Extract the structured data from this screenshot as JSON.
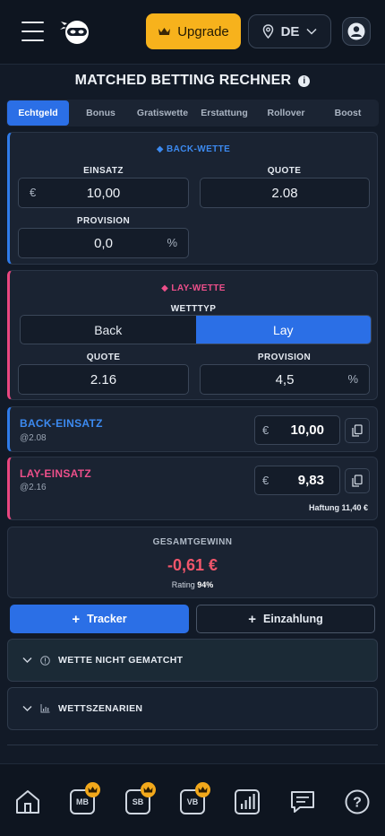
{
  "header": {
    "upgrade_label": "Upgrade",
    "region_label": "DE"
  },
  "page": {
    "title": "MATCHED BETTING RECHNER",
    "info_glyph": "i"
  },
  "tabs": [
    {
      "label": "Echtgeld",
      "active": true
    },
    {
      "label": "Bonus",
      "active": false
    },
    {
      "label": "Gratiswette",
      "active": false
    },
    {
      "label": "Erstattung",
      "active": false
    },
    {
      "label": "Rollover",
      "active": false
    },
    {
      "label": "Boost",
      "active": false
    }
  ],
  "back_bet": {
    "heading": "◆ BACK-WETTE",
    "stake_label": "EINSATZ",
    "stake_prefix": "€",
    "stake_value": "10,00",
    "odds_label": "QUOTE",
    "odds_value": "2.08",
    "commission_label": "PROVISION",
    "commission_value": "0,0",
    "commission_suffix": "%"
  },
  "lay_bet": {
    "heading": "◆ LAY-WETTE",
    "type_label": "WETTTYP",
    "type_options": [
      "Back",
      "Lay"
    ],
    "type_selected": "Lay",
    "odds_label": "QUOTE",
    "odds_value": "2.16",
    "commission_label": "PROVISION",
    "commission_value": "4,5",
    "commission_suffix": "%"
  },
  "back_stake": {
    "title": "BACK-EINSATZ",
    "subtitle": "@2.08",
    "currency": "€",
    "amount": "10,00"
  },
  "lay_stake": {
    "title": "LAY-EINSATZ",
    "subtitle": "@2.16",
    "currency": "€",
    "amount": "9,83",
    "liability": "Haftung 11,40 €"
  },
  "total": {
    "label": "GESAMTGEWINN",
    "value": "-0,61 €",
    "rating_label": "Rating",
    "rating_value": "94%"
  },
  "actions": {
    "tracker_label": "Tracker",
    "deposit_label": "Einzahlung"
  },
  "accordions": {
    "not_matched": "WETTE NICHT GEMATCHT",
    "scenarios": "WETTSZENARIEN"
  },
  "bottom_nav": [
    {
      "label": "",
      "icon": "home-icon"
    },
    {
      "label": "MB",
      "icon": "matched-betting-icon"
    },
    {
      "label": "SB",
      "icon": "sure-bet-icon"
    },
    {
      "label": "VB",
      "icon": "value-bet-icon"
    },
    {
      "label": "",
      "icon": "stats-icon"
    },
    {
      "label": "",
      "icon": "chat-icon"
    },
    {
      "label": "?",
      "icon": "help-icon"
    }
  ],
  "colors": {
    "accent_blue": "#2b6fe6",
    "lay_pink": "#e9467f",
    "upgrade_gold": "#f7b21c",
    "loss_red": "#f2566b"
  }
}
